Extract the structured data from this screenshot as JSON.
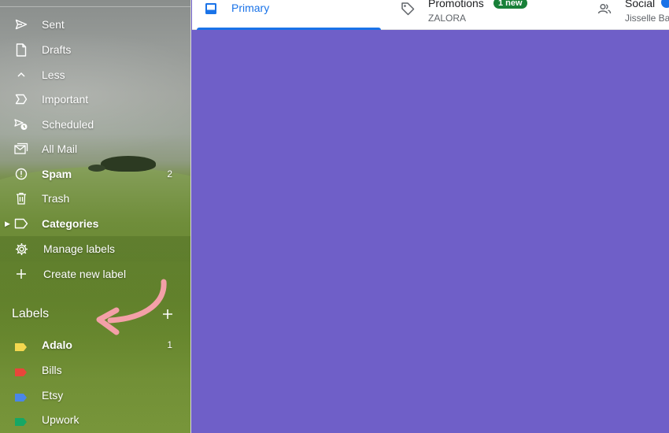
{
  "sidebar": {
    "items": [
      {
        "label": "Sent",
        "icon": "send-icon"
      },
      {
        "label": "Drafts",
        "icon": "draft-icon"
      },
      {
        "label": "Less",
        "icon": "chevron-up-icon"
      },
      {
        "label": "Important",
        "icon": "important-icon"
      },
      {
        "label": "Scheduled",
        "icon": "scheduled-icon"
      },
      {
        "label": "All Mail",
        "icon": "all-mail-icon"
      },
      {
        "label": "Spam",
        "icon": "spam-icon",
        "count": "2"
      },
      {
        "label": "Trash",
        "icon": "trash-icon"
      },
      {
        "label": "Categories",
        "icon": "label-outline-icon"
      },
      {
        "label": "Manage labels",
        "icon": "gear-icon"
      },
      {
        "label": "Create new label",
        "icon": "plus-icon"
      }
    ],
    "labels_header": "Labels",
    "labels": [
      {
        "label": "Adalo",
        "color": "#f4d84f",
        "count": "1"
      },
      {
        "label": "Bills",
        "color": "#e8463a"
      },
      {
        "label": "Etsy",
        "color": "#4a86e8"
      },
      {
        "label": "Upwork",
        "color": "#16a765"
      }
    ]
  },
  "tabs": [
    {
      "title": "Primary",
      "icon": "inbox-icon"
    },
    {
      "title": "Promotions",
      "subtitle": "ZALORA",
      "badge": "1 new",
      "icon": "tag-icon"
    },
    {
      "title": "Social",
      "subtitle": "Jisselle Ba",
      "icon": "people-icon"
    }
  ],
  "colors": {
    "accent": "#1a73e8",
    "badge_green": "#188038",
    "content_bg": "#6f5fc8",
    "arrow": "#f4a0a8"
  }
}
